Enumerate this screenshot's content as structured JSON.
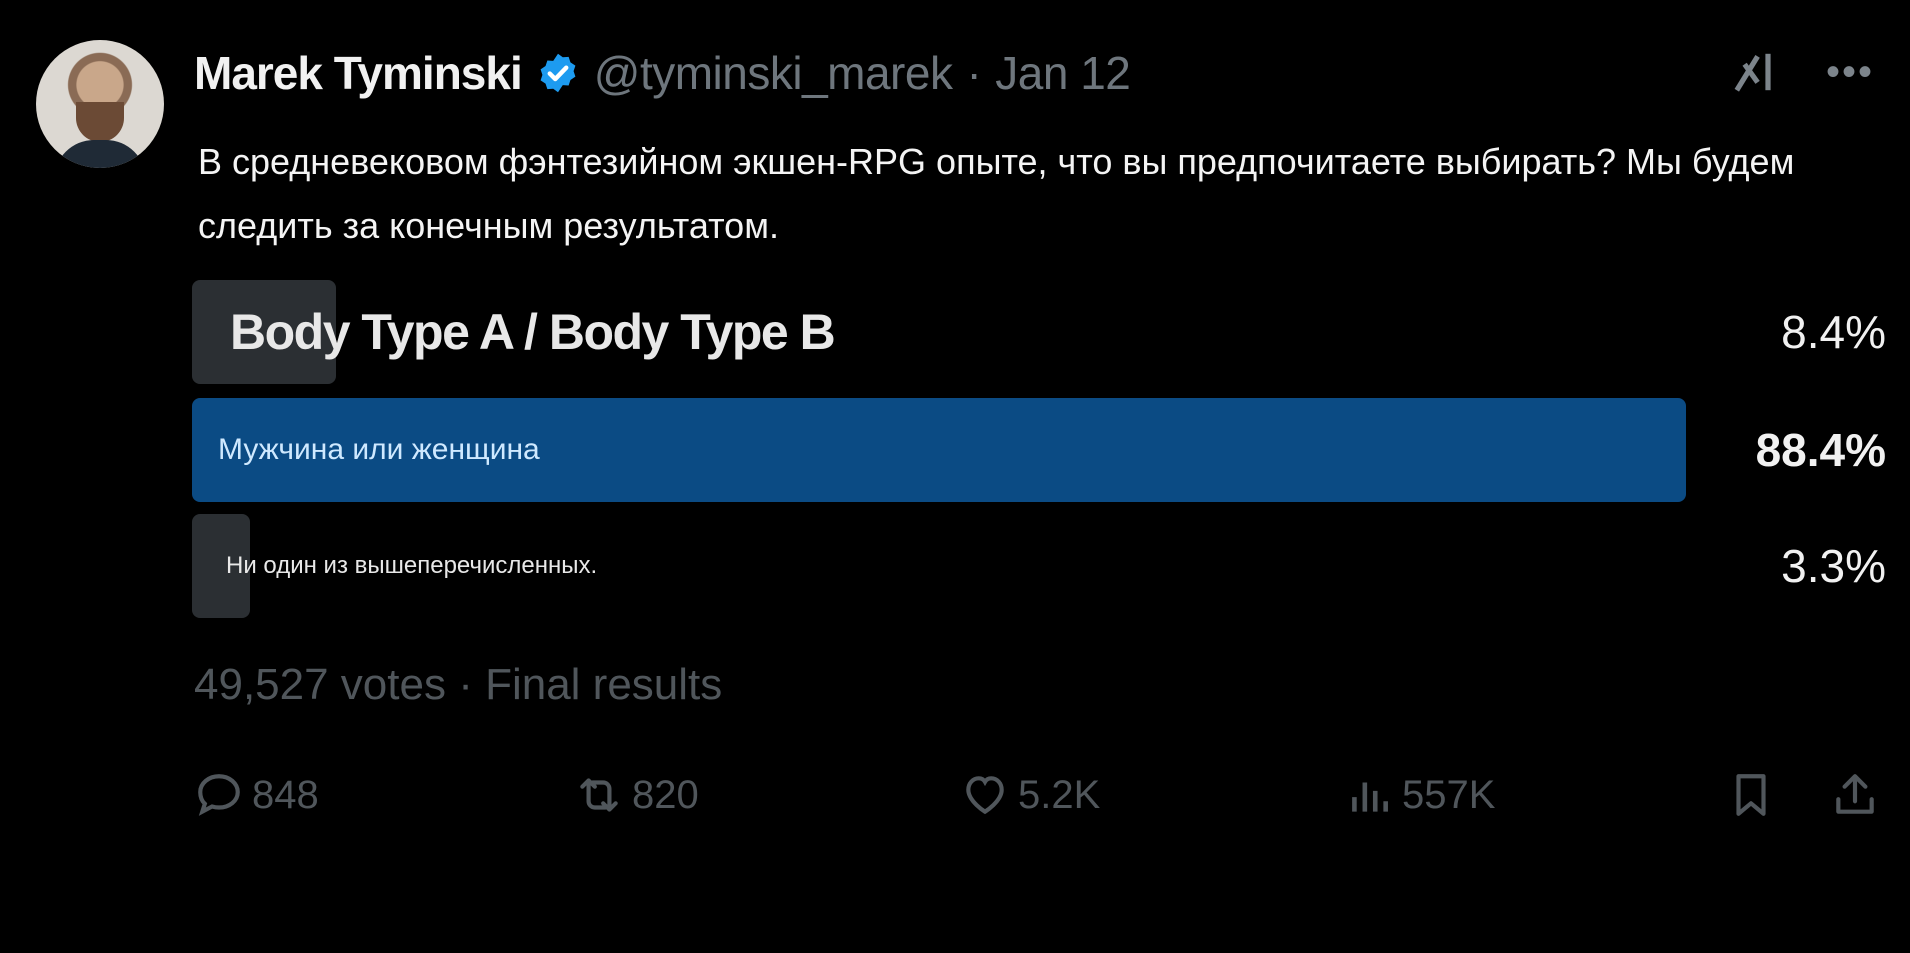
{
  "author": {
    "name": "Marek Tyminski",
    "handle": "@tyminski_marek",
    "separator": "·",
    "date": "Jan 12"
  },
  "icons": [
    "verified-badge-icon",
    "grok-icon",
    "more-icon",
    "reply-icon",
    "repost-icon",
    "like-icon",
    "views-icon",
    "bookmark-icon",
    "share-icon"
  ],
  "colors": {
    "background": "#000000",
    "verified": "#1d9bf0",
    "leading_bar": "#0b4b84",
    "bar": "#2b2f33",
    "muted_text": "#50565b"
  },
  "post": {
    "text": "В средневековом фэнтезийном экшен-RPG опыте, что вы предпочитаете выбирать? Мы будем следить за конечным результатом."
  },
  "poll": {
    "options": [
      {
        "label": "Body Type A / Body Type B",
        "percent": "8.4%",
        "fill": 0.084
      },
      {
        "label": "Мужчина или женщина",
        "percent": "88.4%",
        "fill": 0.884
      },
      {
        "label": "Ни один из вышеперечисленных.",
        "percent": "3.3%",
        "fill": 0.033
      }
    ],
    "votes_text": "49,527 votes · Final results"
  },
  "actions": {
    "reply_count": "848",
    "repost_count": "820",
    "like_count": "5.2K",
    "views_count": "557K"
  }
}
